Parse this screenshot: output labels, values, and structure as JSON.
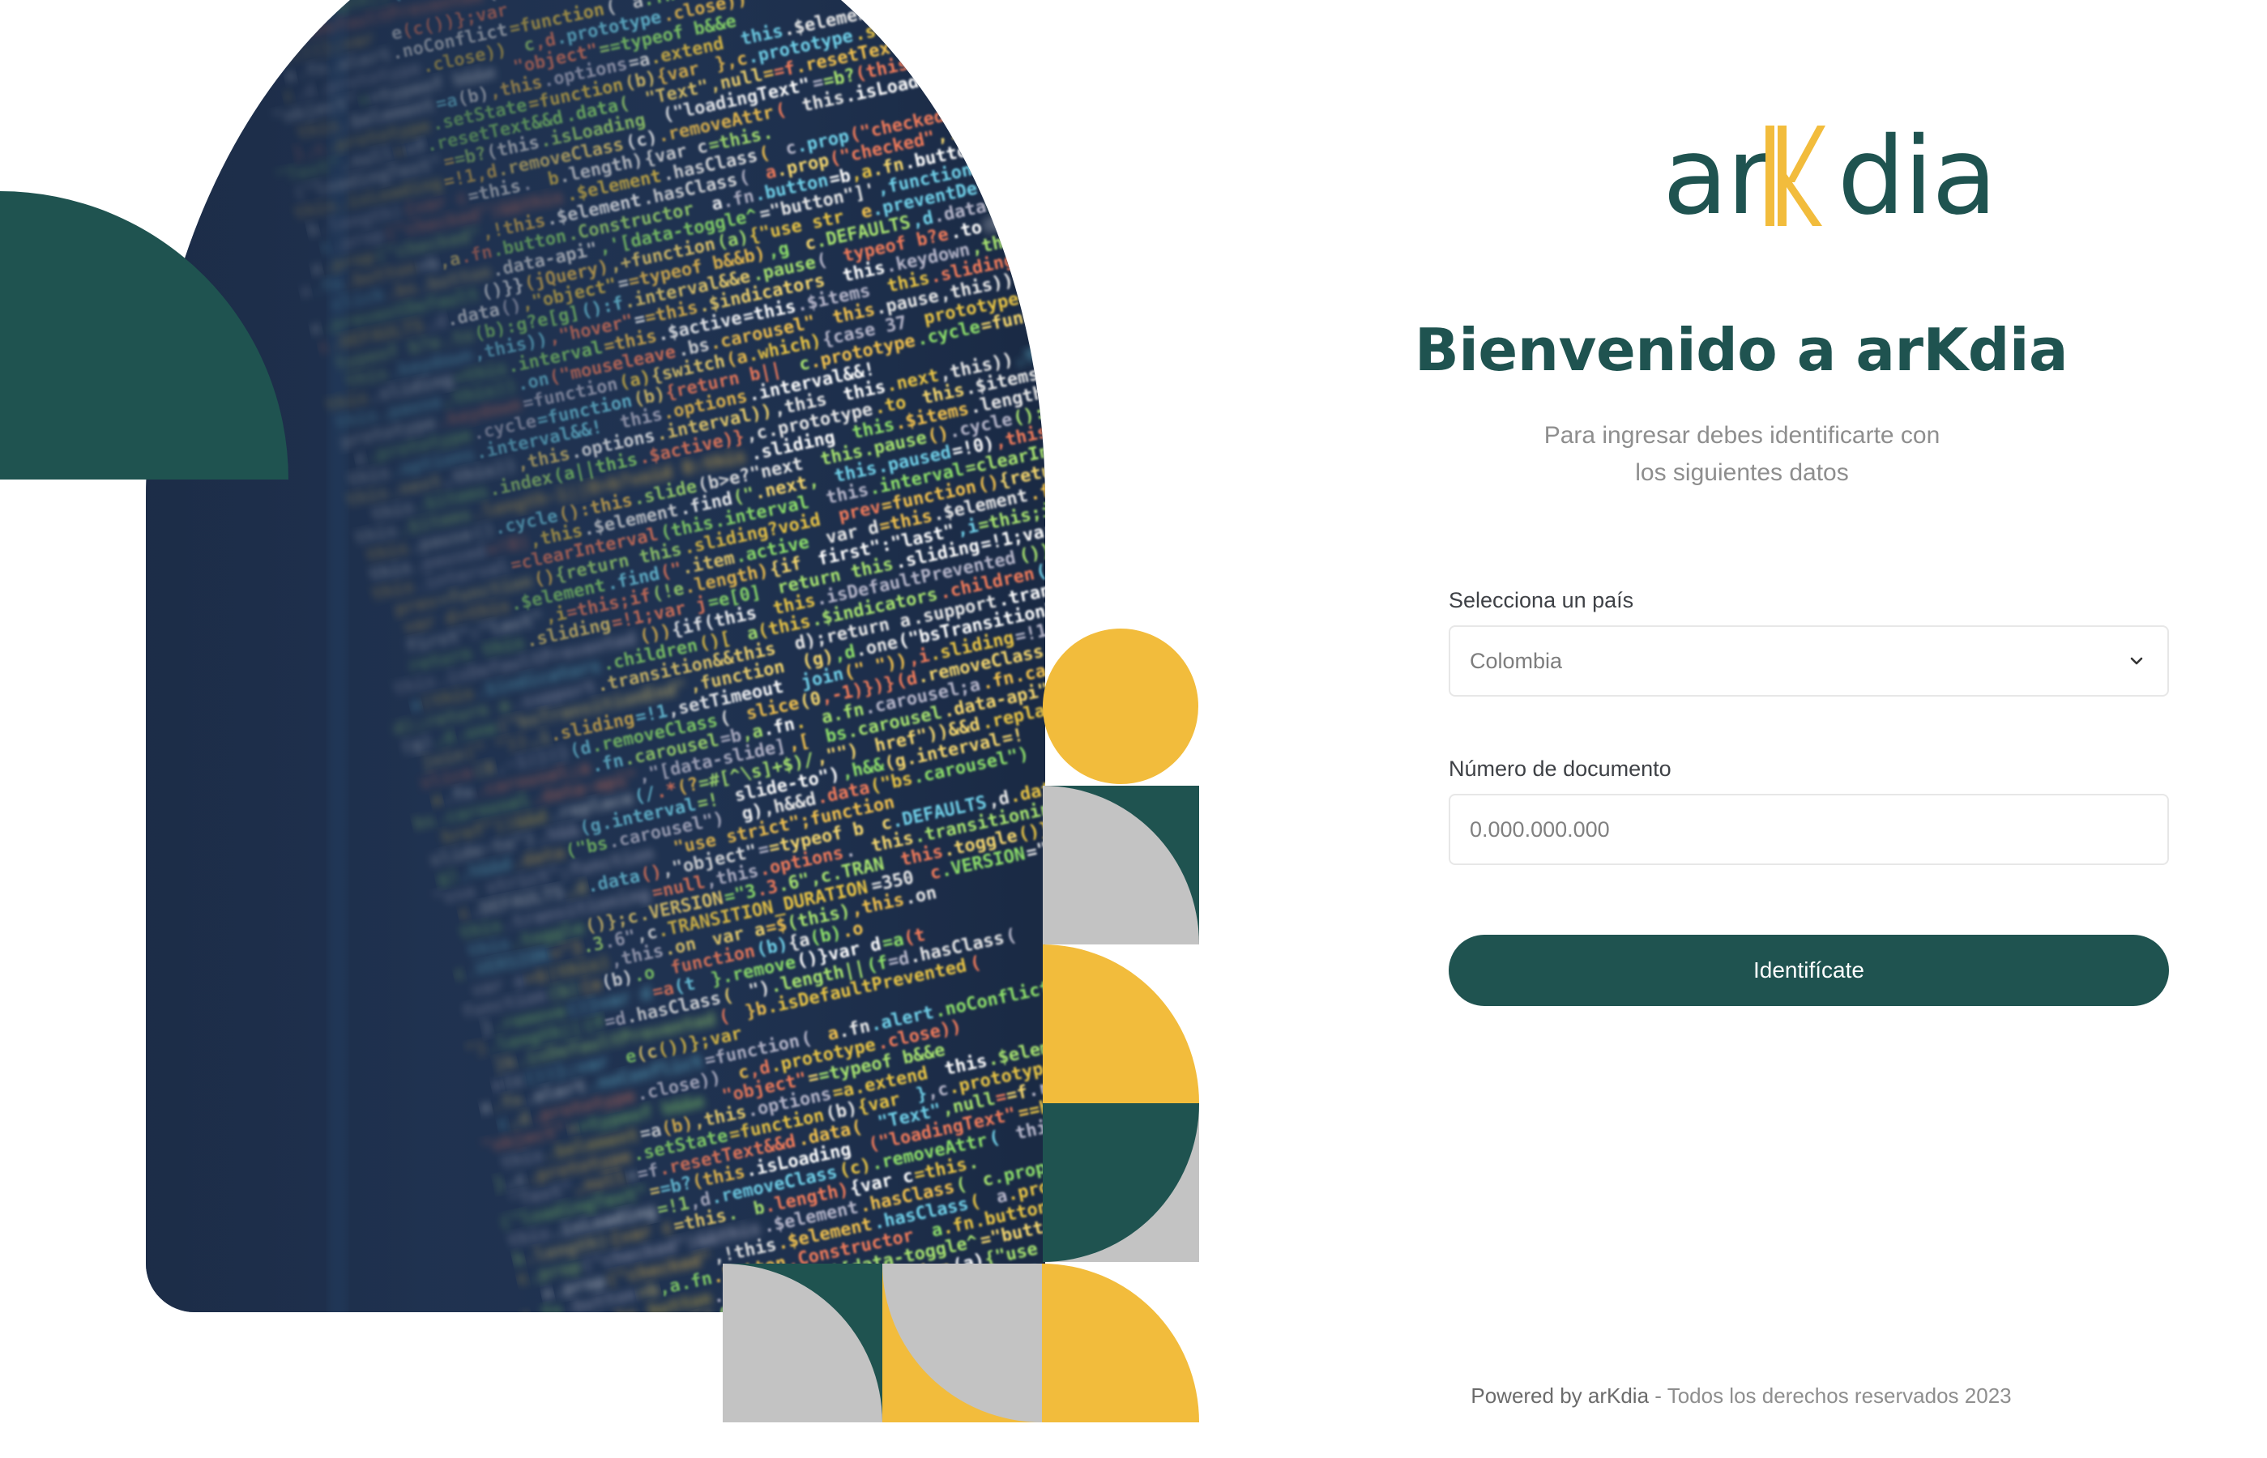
{
  "brand": {
    "logo_text": "arKdia",
    "logo_prefix": "ar",
    "logo_k": "K",
    "logo_suffix": "dia",
    "primary_color": "#1f5350",
    "accent_color": "#f2bc3c",
    "neutral_shape_color": "#c3c3c3"
  },
  "welcome": {
    "title": "Bienvenido a arKdia",
    "subtitle": "Para ingresar debes identificarte con los siguientes datos"
  },
  "form": {
    "country_label": "Selecciona un país",
    "country_value": "Colombia",
    "document_label": "Número de documento",
    "document_placeholder": "0.000.000.000",
    "submit_label": "Identifícate"
  },
  "footer": {
    "powered_by": "Powered by arKdia",
    "separator": " - ",
    "rights": "Todos los derechos reservados 2023"
  },
  "art": {
    "image_subject": "blurred-code-screen",
    "code_sample_lines": [
      "var a=$(this),this.on",
      "function(b){a(b).o",
      "}.remove()}var d=a(t",
      "\").length||(f=d.hasClass(",
      "}b.isDefaultPrevented(",
      "e(c())};var",
      "a.fn.alert.noConflict=function(",
      "c,d.prototype.close))",
      "\"object\"==typeof b&&e",
      "this.$element=a(b),this.options=a.extend",
      "},c.prototype.setState=function(b){var",
      "\"Text\",null==f.resetText&&d.data(",
      "(\"loadingText\"==b?(this.isLoading",
      "this.isLoading=!1,d.removeClass(c).removeAttr(",
      "b.length){var c=this.",
      "c.prop(\"checked\")&&this.$element.hasClass(",
      "a.prop(\"checked\",!this.$element.hasClass(",
      "a.fn.button=b,a.fn.button.Constructor",
      "click.bs.button.data-api\",'[data-toggle^=\"button\"]',function",
      "e.preventDefault()}}(jQuery),+function(a){\"use str",
      "c.DEFAULTS,d.data(),\"object\"==typeof b&&b),g",
      "typeof b?e.to(b):g?e[g]():f.interval&&e.pause(",
      "this.keydown,this)),\"hover\"==this.$indicators",
      "this.sliding=this.interval=this.$active=this.$items",
      "this.pause,this)).on(\"mouseleave.bs.carousel\"",
      "prototype.keydown=function(a){switch(a.which){case 37",
      "c.prototype.cycle=function(b){return b||",
      "this.options.interval&&!",
      "this.next,this)),this.options.interval)),this",
      "this.$items.index(a||this.$active)},c.prototype.to",
      "this.$items.length-1||0>b?void 0:this.sliding",
      "this.pause().cycle():this.slide(b>e?\"next",
      "this.paused=!0),this.$element.find(\".next,",
      "this.interval=clearInterval(this.interval",
      "prev=function(){return this.sliding?void",
      "var d=this.$element.find(\".item.active",
      "first\":\"last\",i=this;if(!e.length){if",
      "return this.sliding=!1;var j=e[0]",
      "this.isDefaultPrevented()){if(this",
      "a(this.$indicators.children()[",
      "d);return a.support.transition&&this",
      "(g),d.one(\"bsTransitionEnd\",function",
      "join(\" \")),i.sliding=!1,setTimeout",
      "slice(0,-1)})}(d.removeClass(",
      "a.fn.carousel;a.fn.carousel=b,a.fn.",
      "bs.carousel.data-api\",\"[data-slide],[",
      "href\"))&&d.replace(/.*(?=#[^\\s]+$)/,\"\")",
      "slide-to\"),h&&(g.interval=!",
      "g),h&&d.data(\"bs.carousel\")",
      "\"use strict\";function",
      "c.DEFAULTS,d.data(),\"object\"==typeof b",
      "this.transitioning=null,this.options.",
      "this.toggle()};c.VERSION=\"3.3.6\",c.TRAN",
      "c.VERSION=\"3.3.6\",c.TRANSITION_DURATION=350"
    ]
  }
}
